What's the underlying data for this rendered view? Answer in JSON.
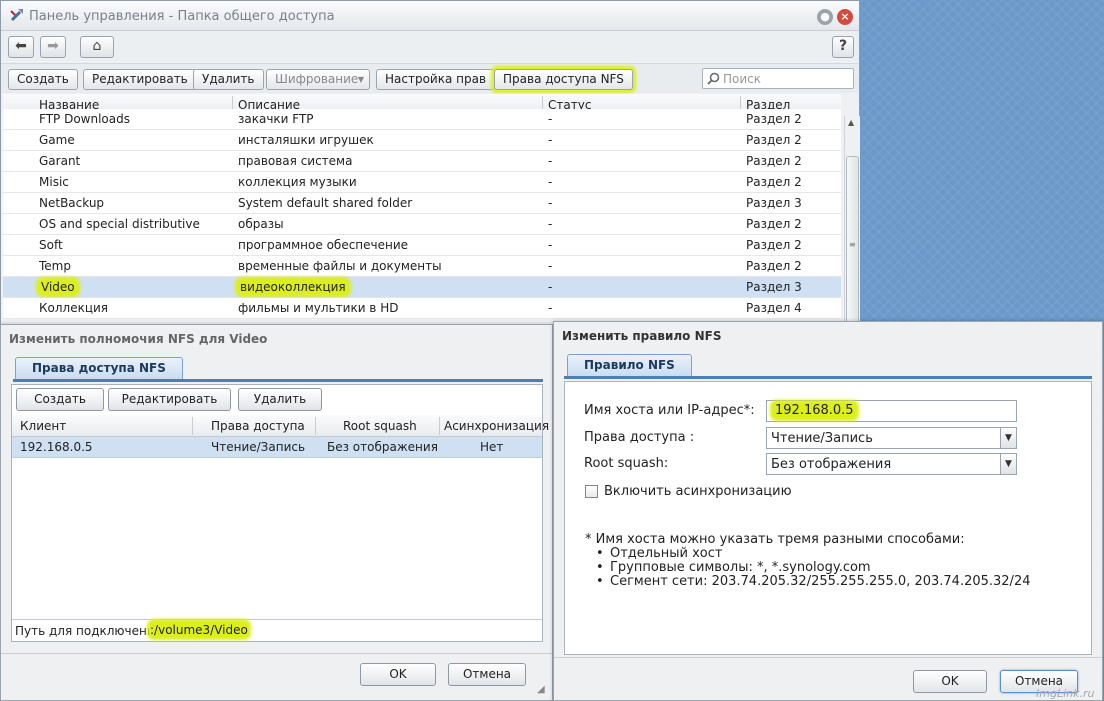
{
  "main_window": {
    "title": "Панель управления - Папка общего доступа",
    "nav": {
      "back_icon": "arrow-left-icon",
      "forward_icon": "arrow-right-icon",
      "home_icon": "home-icon",
      "help_label": "?"
    },
    "toolbar": {
      "create": "Создать",
      "edit": "Редактировать",
      "delete": "Удалить",
      "encryption": "Шифрование",
      "permissions": "Настройка прав",
      "nfs": "Права доступа NFS",
      "search_placeholder": "Поиск"
    },
    "columns": [
      "Название",
      "Описание",
      "Статус",
      "Раздел"
    ],
    "rows": [
      [
        "FTP Downloads",
        "закачки FTP",
        "-",
        "Раздел 2"
      ],
      [
        "Game",
        "инсталяшки игрушек",
        "-",
        "Раздел 2"
      ],
      [
        "Garant",
        "правовая система",
        "-",
        "Раздел 2"
      ],
      [
        "Misic",
        "коллекция музыки",
        "-",
        "Раздел 2"
      ],
      [
        "NetBackup",
        "System default shared folder",
        "-",
        "Раздел 3"
      ],
      [
        "OS and special distributive",
        "образы",
        "-",
        "Раздел 2"
      ],
      [
        "Soft",
        "программное обеспечение",
        "-",
        "Раздел 2"
      ],
      [
        "Temp",
        "временные файлы и документы",
        "-",
        "Раздел 2"
      ],
      [
        "Video",
        "видеоколлекция",
        "-",
        "Раздел 3"
      ],
      [
        "Коллекция",
        "фильмы и мультики в HD",
        "-",
        "Раздел 4"
      ]
    ],
    "selected_row": "Video"
  },
  "nfs_dialog": {
    "title": "Изменить полномочия NFS для Video",
    "tab": "Права доступа NFS",
    "toolbar": {
      "create": "Создать",
      "edit": "Редактировать",
      "delete": "Удалить"
    },
    "columns": [
      "Клиент",
      "Права доступа",
      "Root squash",
      "Асинхронизация"
    ],
    "rows": [
      [
        "192.168.0.5",
        "Чтение/Запись",
        "Без отображения",
        "Нет"
      ]
    ],
    "path_label": "Путь для подключения",
    "path_value": ":/volume3/Video",
    "ok": "OK",
    "cancel": "Отмена"
  },
  "rule_dialog": {
    "title": "Изменить правило NFS",
    "tab": "Правило NFS",
    "host_label": "Имя хоста или IP-адрес*:",
    "host_value": "192.168.0.5",
    "access_label": "Права доступа :",
    "access_value": "Чтение/Запись",
    "squash_label": "Root squash:",
    "squash_value": "Без отображения",
    "async_label": "Включить асинхронизацию",
    "async_checked": false,
    "note_title": "* Имя хоста можно указать тремя разными способами:",
    "note_items": [
      "Отдельный хост",
      "Групповые символы: *, *.synology.com",
      "Сегмент сети: 203.74.205.32/255.255.255.0, 203.74.205.32/24"
    ],
    "ok": "OK",
    "cancel": "Отмена"
  },
  "watermark": "ImgLink.ru",
  "colors": {
    "highlight": "#dcef1a",
    "accent": "#4a7fb7",
    "selected_row": "#cfe0f3"
  }
}
